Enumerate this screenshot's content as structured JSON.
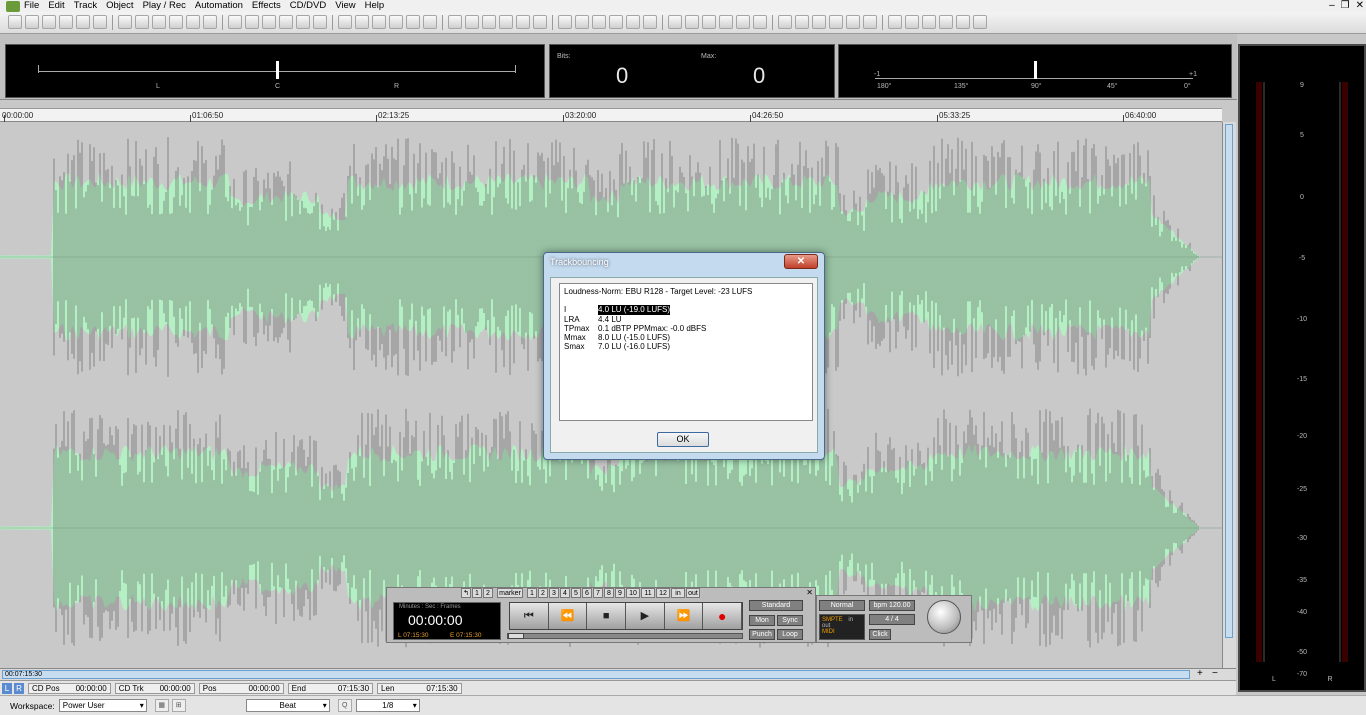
{
  "menu": {
    "items": [
      "File",
      "Edit",
      "Track",
      "Object",
      "Play / Rec",
      "Automation",
      "Effects",
      "CD/DVD",
      "View",
      "Help"
    ]
  },
  "meters": {
    "phase_labels": [
      "L",
      "C",
      "R"
    ],
    "bits_label": "Bits:",
    "bits_value": "0",
    "max_label": "Max:",
    "max_value": "0",
    "corr_labels": [
      "-1",
      "+1"
    ],
    "corr_degrees": [
      "180°",
      "135°",
      "90°",
      "45°",
      "0°"
    ]
  },
  "ruler": {
    "marks": [
      "00:00:00",
      "01:06:50",
      "02:13:25",
      "03:20:00",
      "04:26:50",
      "05:33:25",
      "06:40:00"
    ]
  },
  "peak_meter": {
    "scale": [
      "9",
      "5",
      "0",
      "-5",
      "-10",
      "-15",
      "-20",
      "-25",
      "-30",
      "-35",
      "-40",
      "-50",
      "-70"
    ],
    "channels": [
      "L",
      "R"
    ]
  },
  "dialog": {
    "title": "Trackbouncing",
    "close": "✕",
    "header": "Loudness-Norm: EBU R128 - Target Level: -23 LUFS",
    "rows": [
      {
        "key": "I",
        "value": "4.0 LU (-19.0 LUFS)"
      },
      {
        "key": "LRA",
        "value": "4.4 LU"
      },
      {
        "key": "TPmax",
        "value": "0.1 dBTP  PPMmax: -0.0 dBFS"
      },
      {
        "key": "Mmax",
        "value": "8.0 LU (-15.0 LUFS)"
      },
      {
        "key": "Smax",
        "value": "7.0 LU (-16.0 LUFS)"
      }
    ],
    "ok": "OK"
  },
  "transport": {
    "marker_buttons": [
      "↰",
      "1",
      "2",
      "marker",
      "1",
      "2",
      "3",
      "4",
      "5",
      "6",
      "7",
      "8",
      "9",
      "10",
      "11",
      "12",
      "in",
      "out"
    ],
    "counter_label": "Minutes : Sec : Frames",
    "counter_value": "00:00:00",
    "start_label": "L",
    "start_value": "07:15:30",
    "end_label": "E",
    "end_value": "07:15:30",
    "buttons": [
      "⏮",
      "⏪",
      "■",
      "▶",
      "⏩",
      "●"
    ],
    "mode": "Standard",
    "mon": "Mon",
    "sync": "Sync",
    "punch": "Punch",
    "loop": "Loop",
    "normal": "Normal",
    "bpm": "bpm 120.00",
    "sig": "4 / 4",
    "click": "Click",
    "sync_in": "in",
    "sync_out": "out",
    "sync_brand": "SMPTE",
    "midi": "MIDI"
  },
  "hscroll": {
    "value": "00:07:15:30"
  },
  "status": {
    "lr": [
      "L",
      "R"
    ],
    "cd_pos_label": "CD Pos",
    "cd_pos_value": "00:00:00",
    "cd_trk_label": "CD Trk",
    "cd_trk_value": "00:00:00",
    "pos_label": "Pos",
    "pos_value": "00:00:00",
    "end_label": "End",
    "end_value": "07:15:30",
    "len_label": "Len",
    "len_value": "07:15:30"
  },
  "bottom": {
    "workspace_label": "Workspace:",
    "workspace_value": "Power User",
    "snap_value": "Beat",
    "quant_value": "1/8"
  },
  "colors": {
    "wave_fill": "#b4f0c4",
    "wave_line": "#555555",
    "accent": "#6a9fd0"
  }
}
